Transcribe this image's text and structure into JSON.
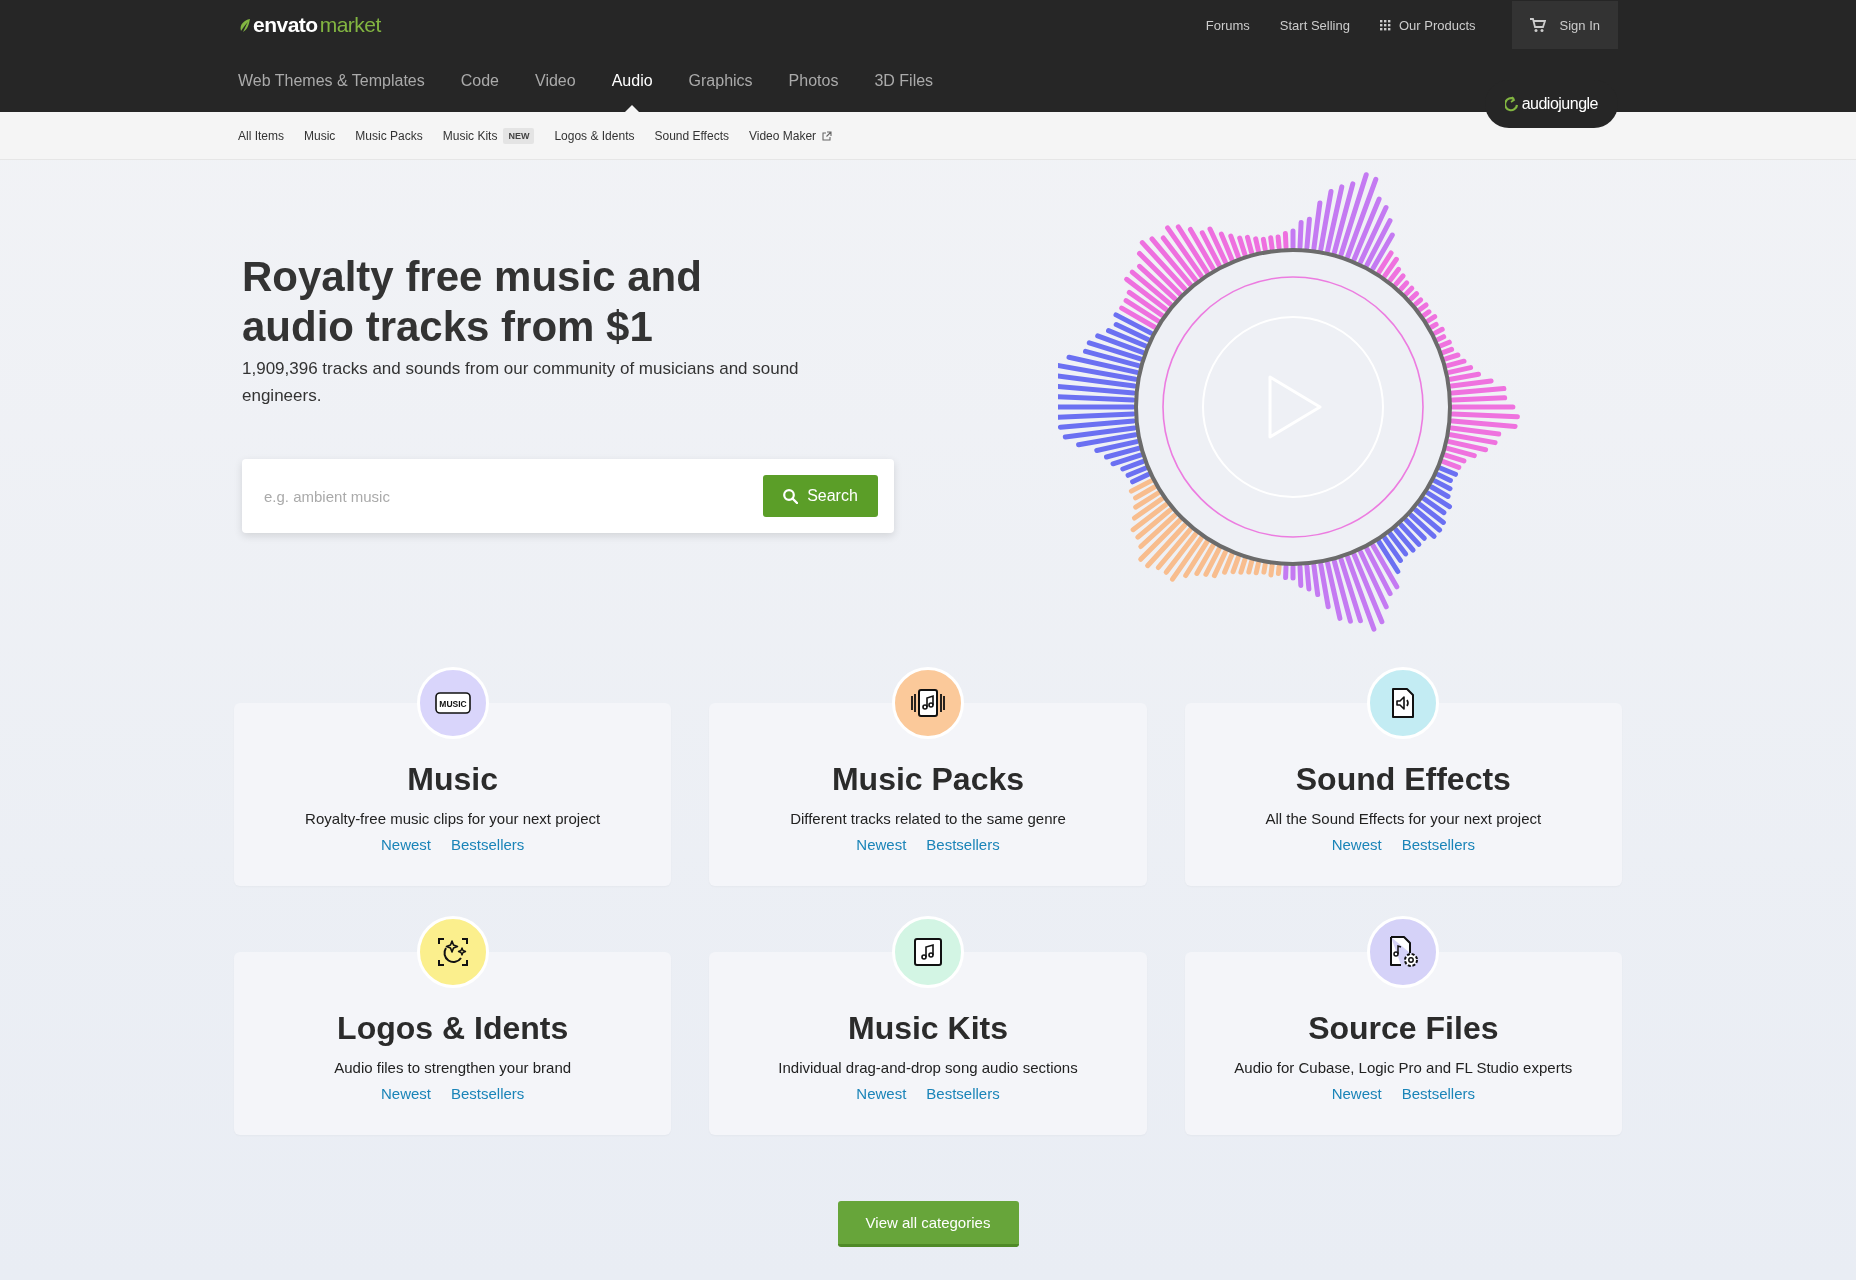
{
  "header": {
    "logo": {
      "brand": "envato",
      "product": "market"
    },
    "top_links": [
      {
        "label": "Forums"
      },
      {
        "label": "Start Selling"
      },
      {
        "label": "Our Products"
      }
    ],
    "sign_in": "Sign In",
    "tabs": [
      {
        "label": "Web Themes & Templates",
        "selected": false
      },
      {
        "label": "Code",
        "selected": false
      },
      {
        "label": "Video",
        "selected": false
      },
      {
        "label": "Audio",
        "selected": true
      },
      {
        "label": "Graphics",
        "selected": false
      },
      {
        "label": "Photos",
        "selected": false
      },
      {
        "label": "3D Files",
        "selected": false
      }
    ],
    "site_badge": "audiojungle"
  },
  "subnav": [
    {
      "label": "All Items",
      "external": false
    },
    {
      "label": "Music",
      "external": false
    },
    {
      "label": "Music Packs",
      "external": false
    },
    {
      "label": "Music Kits",
      "badge": "NEW",
      "external": false
    },
    {
      "label": "Logos & Idents",
      "external": false
    },
    {
      "label": "Sound Effects",
      "external": false
    },
    {
      "label": "Video Maker",
      "external": true
    }
  ],
  "hero": {
    "title": "Royalty free music and audio tracks from $1",
    "subtitle": "1,909,396 tracks and sounds from our community of musicians and sound engineers.",
    "search": {
      "placeholder": "e.g. ambient music",
      "button": "Search"
    }
  },
  "categories": [
    {
      "kind": "music",
      "icon_text": "MUSIC",
      "color": "#d9d5fb",
      "title": "Music",
      "description": "Royalty-free music clips for your next project",
      "links": [
        "Newest",
        "Bestsellers"
      ]
    },
    {
      "kind": "packs",
      "color": "#fbc99a",
      "title": "Music Packs",
      "description": "Different tracks related to the same genre",
      "links": [
        "Newest",
        "Bestsellers"
      ]
    },
    {
      "kind": "sound",
      "color": "#c3ecf3",
      "title": "Sound Effects",
      "description": "All the Sound Effects for your next project",
      "links": [
        "Newest",
        "Bestsellers"
      ]
    },
    {
      "kind": "logos",
      "color": "#fbef8d",
      "title": "Logos & Idents",
      "description": "Audio files to strengthen your brand",
      "links": [
        "Newest",
        "Bestsellers"
      ]
    },
    {
      "kind": "kits",
      "color": "#d3f5e4",
      "title": "Music Kits",
      "description": "Individual drag-and-drop song audio sections",
      "links": [
        "Newest",
        "Bestsellers"
      ]
    },
    {
      "kind": "source",
      "color": "#d5d2f8",
      "title": "Source Files",
      "description": "Audio for Cubase, Logic Pro and FL Studio experts",
      "links": [
        "Newest",
        "Bestsellers"
      ]
    }
  ],
  "view_all": "View all categories"
}
